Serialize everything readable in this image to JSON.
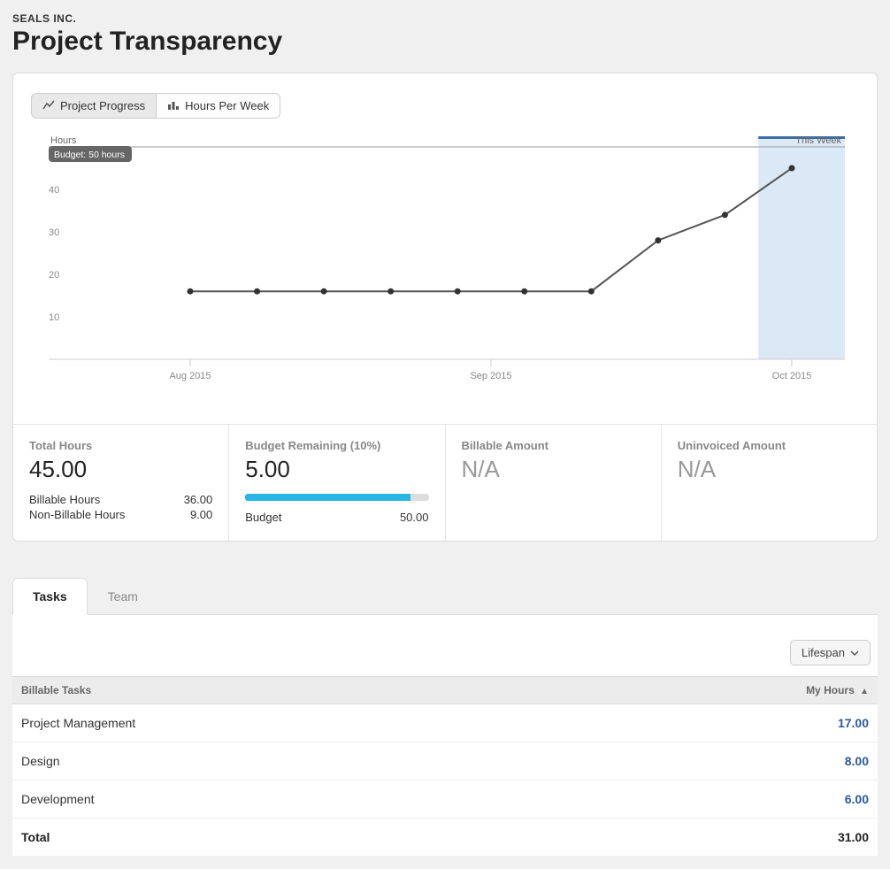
{
  "header": {
    "company": "SEALS INC.",
    "title": "Project Transparency"
  },
  "chart_tabs": {
    "progress": "Project Progress",
    "hours": "Hours Per Week"
  },
  "chart_labels": {
    "yaxis": "Hours",
    "this_week": "This Week",
    "budget_badge": "Budget: 50 hours"
  },
  "chart_data": {
    "type": "line",
    "title": "",
    "xlabel": "",
    "ylabel": "Hours",
    "ylim": [
      0,
      50
    ],
    "yticks": [
      10,
      20,
      30,
      40
    ],
    "categories": [
      "Aug 2015",
      "Sep 2015",
      "Oct 2015"
    ],
    "budget_line": 50,
    "series": [
      {
        "name": "Hours",
        "values": [
          16,
          16,
          16,
          16,
          16,
          16,
          16,
          28,
          34,
          45
        ]
      }
    ],
    "highlight_last": true
  },
  "stats": {
    "total_hours": {
      "label": "Total Hours",
      "value": "45.00",
      "sub": [
        {
          "label": "Billable Hours",
          "value": "36.00"
        },
        {
          "label": "Non-Billable Hours",
          "value": "9.00"
        }
      ]
    },
    "budget_remaining": {
      "label": "Budget Remaining (10%)",
      "value": "5.00",
      "progress_pct": 90,
      "sub": [
        {
          "label": "Budget",
          "value": "50.00"
        }
      ]
    },
    "billable_amount": {
      "label": "Billable Amount",
      "value": "N/A"
    },
    "uninvoiced_amount": {
      "label": "Uninvoiced Amount",
      "value": "N/A"
    }
  },
  "lower_tabs": {
    "tasks": "Tasks",
    "team": "Team"
  },
  "filter": {
    "label": "Lifespan"
  },
  "tasks_table": {
    "col_task": "Billable Tasks",
    "col_hours": "My Hours",
    "rows": [
      {
        "name": "Project Management",
        "hours": "17.00"
      },
      {
        "name": "Design",
        "hours": "8.00"
      },
      {
        "name": "Development",
        "hours": "6.00"
      }
    ],
    "total_label": "Total",
    "total_value": "31.00"
  }
}
